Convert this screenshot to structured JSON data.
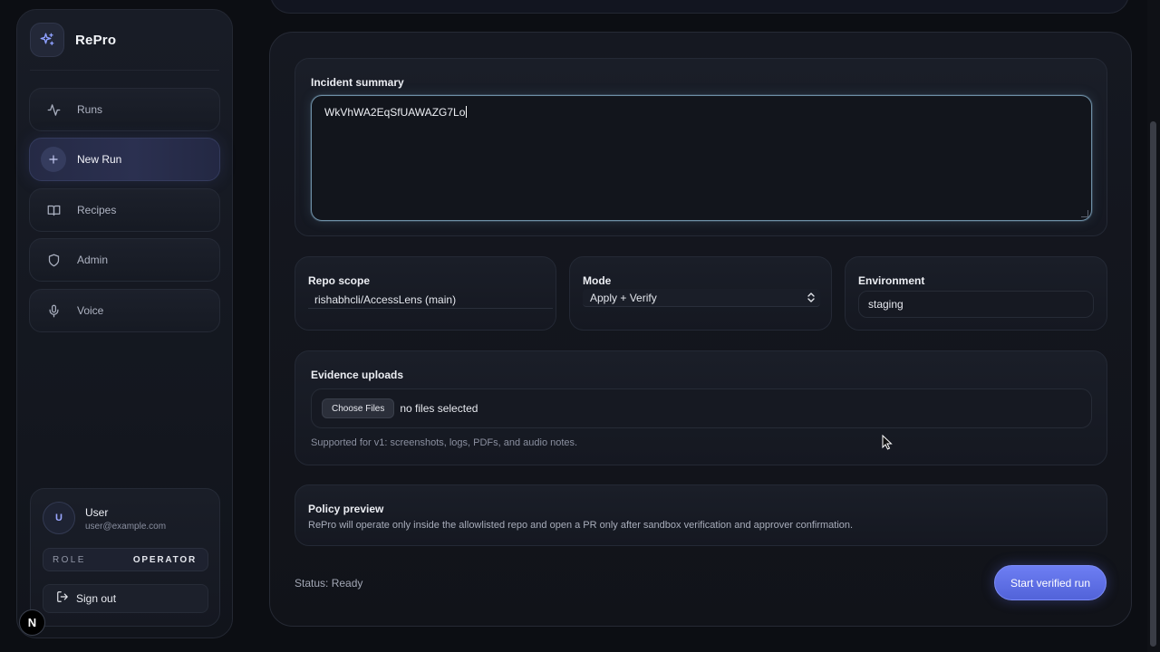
{
  "app": {
    "name": "RePro"
  },
  "sidebar": {
    "items": [
      {
        "label": "Runs",
        "icon": "activity-icon",
        "active": false
      },
      {
        "label": "New Run",
        "icon": "plus-icon",
        "active": true
      },
      {
        "label": "Recipes",
        "icon": "book-icon",
        "active": false
      },
      {
        "label": "Admin",
        "icon": "shield-icon",
        "active": false
      },
      {
        "label": "Voice",
        "icon": "mic-icon",
        "active": false
      }
    ],
    "user": {
      "initial": "U",
      "name": "User",
      "email": "user@example.com",
      "role_label": "ROLE",
      "role_value": "OPERATOR",
      "signout_label": "Sign out"
    },
    "badge": "N"
  },
  "form": {
    "incident": {
      "label": "Incident summary",
      "value": "WkVhWA2EqSfUAWAZG7Lo"
    },
    "repo": {
      "label": "Repo scope",
      "value": "rishabhcli/AccessLens (main)"
    },
    "mode": {
      "label": "Mode",
      "value": "Apply + Verify"
    },
    "environment": {
      "label": "Environment",
      "value": "staging"
    },
    "evidence": {
      "label": "Evidence uploads",
      "button": "Choose Files",
      "status": "no files selected",
      "helper": "Supported for v1: screenshots, logs, PDFs, and audio notes."
    },
    "policy": {
      "label": "Policy preview",
      "text": "RePro will operate only inside the allowlisted repo and open a PR only after sandbox verification and approver confirmation."
    },
    "status": "Status: Ready",
    "submit_label": "Start verified run"
  },
  "colors": {
    "accent": "#5f70e6",
    "background": "#0c0e13",
    "focus_ring": "#6e8fa6"
  }
}
